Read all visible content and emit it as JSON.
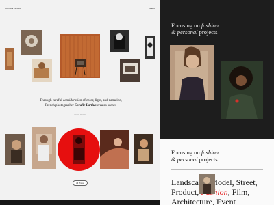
{
  "header": {
    "brand": "Carlotta Lartius",
    "menu": "Menu"
  },
  "intro": {
    "line1_pre": "Through careful ",
    "line1_em": "consideration",
    "line1_post": " of color, light, and narrative,",
    "line2_pre": "French photographer ",
    "line2_name": "Coralie Lartius",
    "line2_post": " creates scenes",
    "read_more": "READ MORE"
  },
  "gallery": {
    "all_button": "All Photos"
  },
  "right": {
    "heading_pre": "Focusing on ",
    "heading_em1": "fashion",
    "heading_mid": "& ",
    "heading_em2": "personal",
    "heading_post": " projects"
  },
  "right_bottom": {
    "heading_pre": "Focusing on ",
    "heading_em1": "fashion",
    "heading_mid": "& ",
    "heading_em2": "personal",
    "heading_post": " projects",
    "tags_pre": "Landscape, Model, Street, Product, ",
    "tags_highlight": "Fashion",
    "tags_post": ", Film, Architecture, Event"
  },
  "colors": {
    "accent": "#e60f0f",
    "dark": "#1d1d1d",
    "light": "#f2f2f2"
  }
}
